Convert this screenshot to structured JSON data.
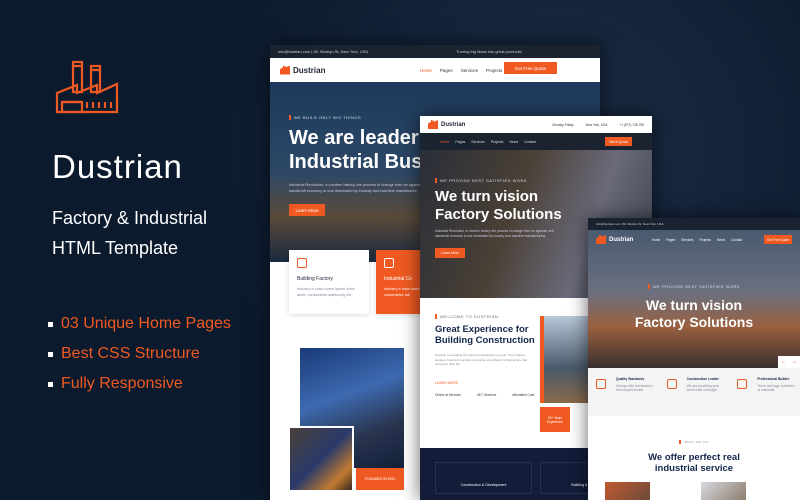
{
  "promo": {
    "brand": "Dustrian",
    "subtitle_line1": "Factory & Industrial",
    "subtitle_line2": "HTML Template",
    "features": [
      "03 Unique Home Pages",
      "Best CSS Structure",
      "Fully Responsive"
    ],
    "logo_icon": "factory-icon",
    "accent_color": "#f05a22",
    "background_color": "#0c1a2e"
  },
  "home1": {
    "topbar_email": "info@fustrian.com",
    "topbar_address": "60, Broklyn St, New York, USA",
    "topbar_tagline": "Turning big ideas into great products!",
    "logo": "Dustrian",
    "nav": [
      "Home",
      "Pages",
      "Services",
      "Projects",
      "News",
      "Contact"
    ],
    "cta": "Get Free Quote",
    "eyebrow": "WE BUILD ONLY BIG THINGS",
    "title_line1": "We are leader",
    "title_line2": "Industrial Busi",
    "text": "Industrial Revolution, in modern history, the process of change from an agrarian and handicraft economy to one dominated by industry and machine manufacture.",
    "button": "Learn More",
    "cards": [
      {
        "title": "Building Factory",
        "text": "Industry is main lorem ipsum dolor amet, consectetur adipiscing elit."
      },
      {
        "title": "Industrial Co",
        "text": "Industry a main lorem amet, consectetur adi"
      }
    ],
    "founded": "FOUNDED IN 1991"
  },
  "home2": {
    "logo": "Dustrian",
    "info": [
      "Monday-Friday",
      "New York, USA",
      "+1 (571) 745-789"
    ],
    "nav": [
      "Home",
      "Pages",
      "Services",
      "Projects",
      "News",
      "Contact"
    ],
    "cta": "Get A Quote",
    "eyebrow": "WE PROVIDE BEST SATISFIED WORK",
    "title_line1": "We turn vision",
    "title_line2": "Factory Solutions",
    "text": "Industrial Revolution, in modern history, the process of change from an agrarian and handicraft economy to one dominated by industry and machine manufacturing.",
    "button": "Learn More",
    "about_eyebrow": "WELCOME TO DUSTRIAN",
    "about_title_line1": "Great Experience for",
    "about_title_line2": "Building Construction",
    "about_text": "Dustrian is a leading international infrastructure group. They finance, develop, build and maintain innovative and efficient infrastructure that underpins daily life.",
    "about_link": "LEARN MORE",
    "stats": [
      "Online at Services",
      "24/7 Services",
      "Affordable Cost"
    ],
    "experience": "25+ Years Experience",
    "services": [
      "Construction & Development",
      "Building & Decoration"
    ]
  },
  "home3": {
    "logo": "Dustrian",
    "nav": [
      "Home",
      "Pages",
      "Services",
      "Projects",
      "News",
      "Contact"
    ],
    "cta": "Get Free Quote",
    "eyebrow": "WE PROVIDE BEST SATISFIED WORK",
    "title_line1": "We turn vision",
    "title_line2": "Factory Solutions",
    "features": [
      {
        "title": "Quality Standards",
        "text": "Having solid construction from expert worker"
      },
      {
        "title": "Construction Leader",
        "text": "We are providing year world wide coverage"
      },
      {
        "title": "Professional Builder",
        "text": "There are huge collection of industrial"
      }
    ],
    "section_eyebrow": "WHAT WE DO",
    "section_title_line1": "We offer perfect real",
    "section_title_line2": "industrial service"
  }
}
